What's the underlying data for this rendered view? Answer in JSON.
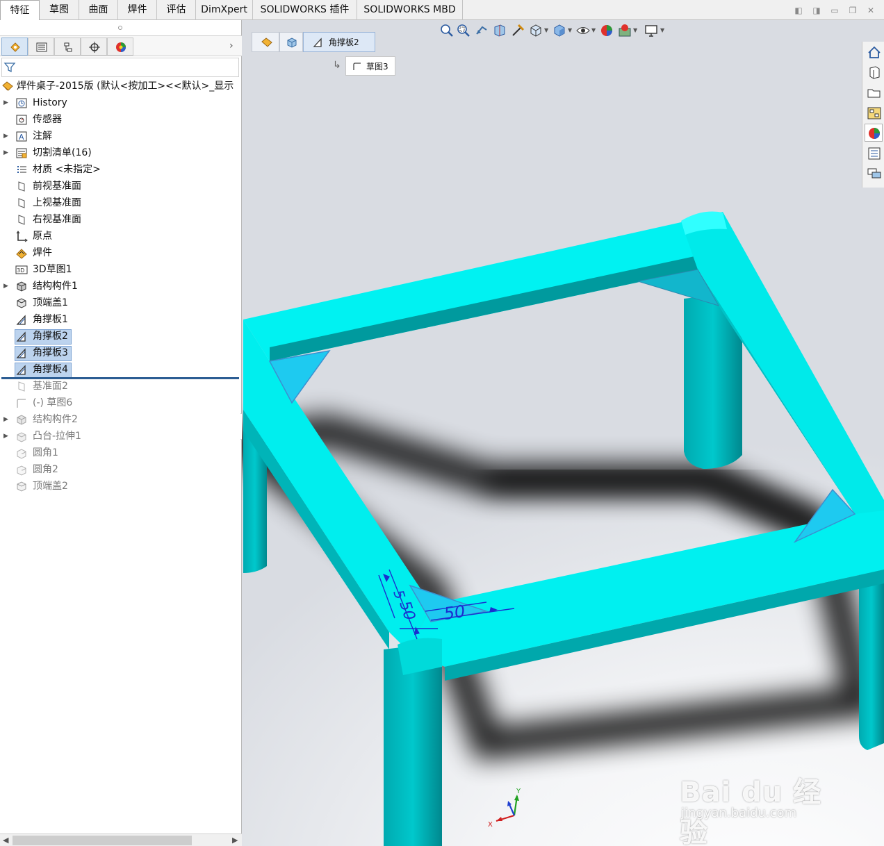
{
  "command_tabs": [
    {
      "label": "特征",
      "active": true
    },
    {
      "label": "草图"
    },
    {
      "label": "曲面"
    },
    {
      "label": "焊件"
    },
    {
      "label": "评估"
    },
    {
      "label": "DimXpert"
    },
    {
      "label": "SOLIDWORKS 插件"
    },
    {
      "label": "SOLIDWORKS MBD"
    }
  ],
  "feature_manager": {
    "tabs": [
      "feature-manager-icon",
      "property-manager-icon",
      "configuration-manager-icon",
      "dimxpert-manager-icon",
      "display-manager-icon"
    ],
    "root": "焊件桌子-2015版  (默认<按加工><<默认>_显示",
    "items": [
      {
        "label": "History",
        "icon": "history-icon",
        "expandable": true
      },
      {
        "label": "传感器",
        "icon": "sensor-icon"
      },
      {
        "label": "注解",
        "icon": "annotation-icon",
        "expandable": true
      },
      {
        "label": "切割清单(16)",
        "icon": "cutlist-icon",
        "expandable": true
      },
      {
        "label": "材质 <未指定>",
        "icon": "material-icon"
      },
      {
        "label": "前视基准面",
        "icon": "plane-icon"
      },
      {
        "label": "上视基准面",
        "icon": "plane-icon"
      },
      {
        "label": "右视基准面",
        "icon": "plane-icon"
      },
      {
        "label": "原点",
        "icon": "origin-icon"
      },
      {
        "label": "焊件",
        "icon": "weldment-icon"
      },
      {
        "label": "3D草图1",
        "icon": "sketch3d-icon"
      },
      {
        "label": "结构构件1",
        "icon": "structural-member-icon",
        "expandable": true
      },
      {
        "label": "顶端盖1",
        "icon": "end-cap-icon"
      },
      {
        "label": "角撑板1",
        "icon": "gusset-icon"
      },
      {
        "label": "角撑板2",
        "icon": "gusset-icon",
        "selected": true
      },
      {
        "label": "角撑板3",
        "icon": "gusset-icon",
        "selected": true
      },
      {
        "label": "角撑板4",
        "icon": "gusset-icon",
        "selected": true
      },
      {
        "label": "基准面2",
        "icon": "plane-icon",
        "suppressed": true
      },
      {
        "label": "(-) 草图6",
        "icon": "sketch-icon",
        "suppressed": true
      },
      {
        "label": "结构构件2",
        "icon": "structural-member-icon",
        "expandable": true,
        "suppressed": true
      },
      {
        "label": "凸台-拉伸1",
        "icon": "extrude-icon",
        "expandable": true,
        "suppressed": true
      },
      {
        "label": "圆角1",
        "icon": "fillet-icon",
        "suppressed": true
      },
      {
        "label": "圆角2",
        "icon": "fillet-icon",
        "suppressed": true
      },
      {
        "label": "顶端盖2",
        "icon": "end-cap-icon",
        "suppressed": true
      }
    ]
  },
  "breadcrumb": {
    "segments": [
      {
        "label": "",
        "icon": "assembly-icon"
      },
      {
        "label": "",
        "icon": "part-icon"
      },
      {
        "label": "角撑板2",
        "icon": "gusset-icon"
      }
    ],
    "child": {
      "label": "草图3",
      "icon": "sketch-icon"
    }
  },
  "view_toolbar": [
    "zoom-to-fit-icon",
    "zoom-to-area-icon",
    "previous-view-icon",
    "section-view-icon",
    "dynamic-annotation-icon",
    "view-orientation-icon",
    "display-style-icon",
    "hide-show-icon",
    "edit-appearance-icon",
    "apply-scene-icon",
    "view-settings-icon"
  ],
  "task_pane": [
    "home-icon",
    "design-library-icon",
    "file-explorer-icon",
    "view-palette-icon",
    "appearances-icon",
    "custom-properties-icon",
    "forum-icon"
  ],
  "model": {
    "color": "#00e5e5",
    "dimensions": [
      "5",
      "50",
      "50"
    ]
  },
  "triad": {
    "x": "X",
    "y": "Y"
  },
  "watermark": {
    "brand": "Bai du 经验",
    "url": "jingyan.baidu.com"
  }
}
